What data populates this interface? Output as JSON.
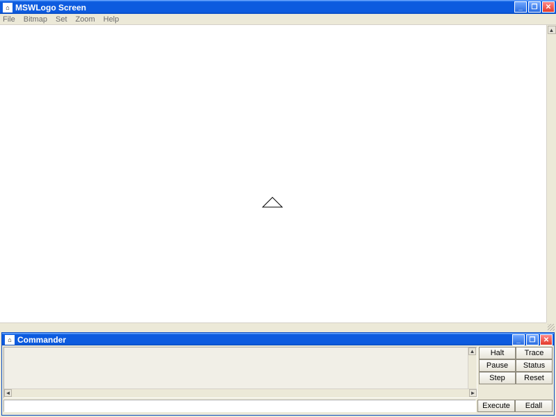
{
  "main_window": {
    "title": "MSWLogo Screen",
    "menu": [
      "File",
      "Bitmap",
      "Set",
      "Zoom",
      "Help"
    ]
  },
  "commander": {
    "title": "Commander",
    "buttons": {
      "halt": "Halt",
      "trace": "Trace",
      "pause": "Pause",
      "status": "Status",
      "step": "Step",
      "reset": "Reset",
      "execute": "Execute",
      "edall": "Edall"
    },
    "input_value": ""
  }
}
